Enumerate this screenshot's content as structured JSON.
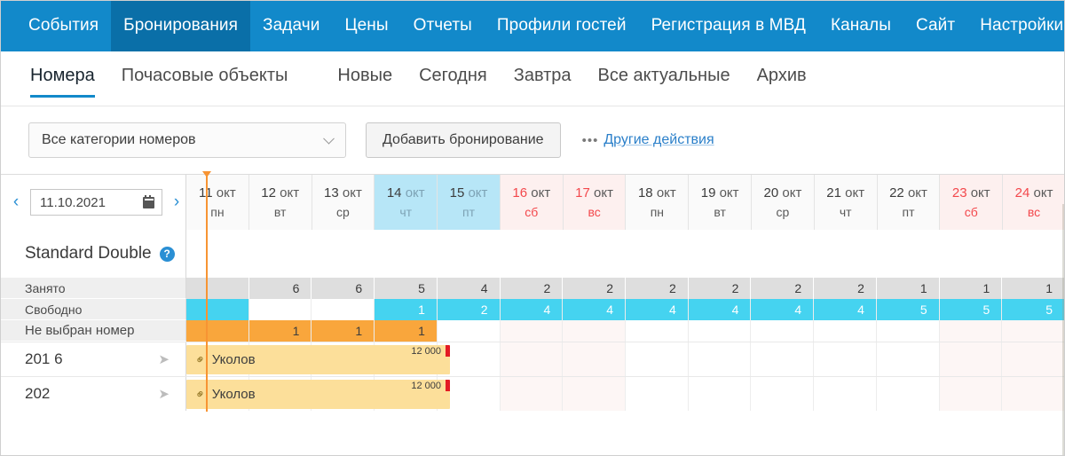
{
  "topnav": {
    "items": [
      {
        "label": "События",
        "active": false
      },
      {
        "label": "Бронирования",
        "active": true
      },
      {
        "label": "Задачи",
        "active": false
      },
      {
        "label": "Цены",
        "active": false
      },
      {
        "label": "Отчеты",
        "active": false
      },
      {
        "label": "Профили гостей",
        "active": false
      },
      {
        "label": "Регистрация в МВД",
        "active": false
      },
      {
        "label": "Каналы",
        "active": false
      },
      {
        "label": "Сайт",
        "active": false
      },
      {
        "label": "Настройки",
        "active": false
      }
    ],
    "bg_color": "#1289ca",
    "active_bg_color": "#0a6fa8"
  },
  "subtabs": {
    "items": [
      {
        "label": "Номера",
        "active": true,
        "gap": false
      },
      {
        "label": "Почасовые объекты",
        "active": false,
        "gap": false
      },
      {
        "label": "Новые",
        "active": false,
        "gap": true
      },
      {
        "label": "Сегодня",
        "active": false,
        "gap": false
      },
      {
        "label": "Завтра",
        "active": false,
        "gap": false
      },
      {
        "label": "Все актуальные",
        "active": false,
        "gap": false
      },
      {
        "label": "Архив",
        "active": false,
        "gap": false
      }
    ],
    "accent_color": "#1289ca"
  },
  "toolbar": {
    "category_select": {
      "value": "Все категории номеров",
      "icon": "chevron-down-icon"
    },
    "add_booking_label": "Добавить бронирование",
    "other_actions": {
      "dots": "•••",
      "label": "Другие действия",
      "color": "#2a7fc9"
    }
  },
  "datenav": {
    "prev_icon": "‹",
    "next_icon": "›",
    "date_value": "11.10.2021",
    "calendar_icon": "calendar-icon"
  },
  "calendar": {
    "columns": [
      {
        "day": "11",
        "month": "окт",
        "dow": "пн",
        "weekend": false,
        "selected": false
      },
      {
        "day": "12",
        "month": "окт",
        "dow": "вт",
        "weekend": false,
        "selected": false
      },
      {
        "day": "13",
        "month": "окт",
        "dow": "ср",
        "weekend": false,
        "selected": false
      },
      {
        "day": "14",
        "month": "окт",
        "dow": "чт",
        "weekend": false,
        "selected": true
      },
      {
        "day": "15",
        "month": "окт",
        "dow": "пт",
        "weekend": false,
        "selected": true
      },
      {
        "day": "16",
        "month": "окт",
        "dow": "сб",
        "weekend": true,
        "selected": false
      },
      {
        "day": "17",
        "month": "окт",
        "dow": "вс",
        "weekend": true,
        "selected": false
      },
      {
        "day": "18",
        "month": "окт",
        "dow": "пн",
        "weekend": false,
        "selected": false
      },
      {
        "day": "19",
        "month": "окт",
        "dow": "вт",
        "weekend": false,
        "selected": false
      },
      {
        "day": "20",
        "month": "окт",
        "dow": "ср",
        "weekend": false,
        "selected": false
      },
      {
        "day": "21",
        "month": "окт",
        "dow": "чт",
        "weekend": false,
        "selected": false
      },
      {
        "day": "22",
        "month": "окт",
        "dow": "пт",
        "weekend": false,
        "selected": false
      },
      {
        "day": "23",
        "month": "окт",
        "dow": "сб",
        "weekend": true,
        "selected": false
      },
      {
        "day": "24",
        "month": "окт",
        "dow": "вс",
        "weekend": true,
        "selected": false
      }
    ],
    "today_column_index": 0
  },
  "category": {
    "title": "Standard Double",
    "help_icon": "?"
  },
  "stats": {
    "occupied": {
      "label": "Занято",
      "values": [
        "",
        "6",
        "6",
        "5",
        "4",
        "2",
        "2",
        "2",
        "2",
        "2",
        "2",
        "1",
        "1",
        "1"
      ]
    },
    "free": {
      "label": "Свободно",
      "values": [
        "",
        "",
        "",
        "1",
        "2",
        "4",
        "4",
        "4",
        "4",
        "4",
        "4",
        "5",
        "5",
        "5"
      ],
      "filled": [
        true,
        false,
        false,
        true,
        true,
        true,
        true,
        true,
        true,
        true,
        true,
        true,
        true,
        true
      ],
      "color": "#45d3f0"
    },
    "no_room": {
      "label": "Не выбран номер",
      "values": [
        "",
        "1",
        "1",
        "1",
        "",
        "",
        "",
        "",
        "",
        "",
        "",
        "",
        "",
        ""
      ],
      "filled": [
        true,
        true,
        true,
        true,
        false,
        false,
        false,
        false,
        false,
        false,
        false,
        false,
        false,
        false
      ],
      "color": "#f9a63c"
    }
  },
  "rooms": [
    {
      "number": "201 6",
      "action_icon": "paper-plane-icon",
      "booking": {
        "guest": "Уколов",
        "price": "12 000",
        "link_icon": "chain-link-icon",
        "start_col": 0,
        "span_cols": 4.2,
        "color": "#fcdf9a",
        "marker_color": "#e31b23"
      }
    },
    {
      "number": "202",
      "action_icon": "paper-plane-icon",
      "booking": {
        "guest": "Уколов",
        "price": "12 000",
        "link_icon": "chain-link-icon",
        "start_col": 0,
        "span_cols": 4.2,
        "color": "#fcdf9a",
        "marker_color": "#e31b23"
      }
    }
  ]
}
